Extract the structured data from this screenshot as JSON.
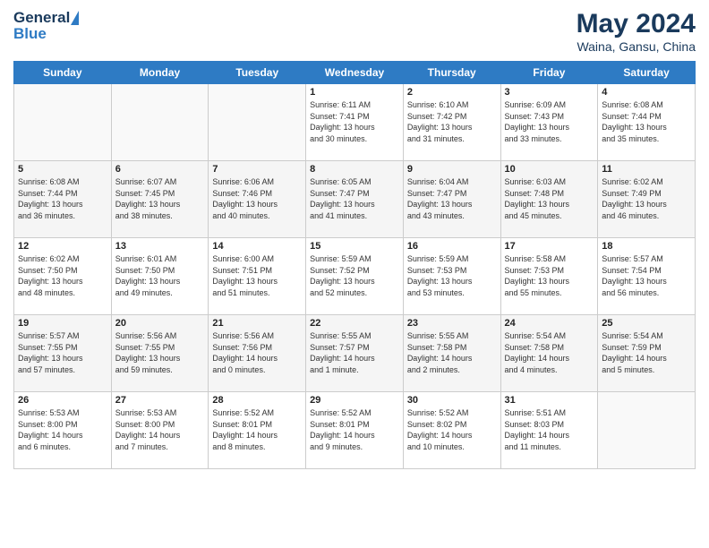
{
  "header": {
    "logo_general": "General",
    "logo_blue": "Blue",
    "title": "May 2024",
    "subtitle": "Waina, Gansu, China"
  },
  "weekdays": [
    "Sunday",
    "Monday",
    "Tuesday",
    "Wednesday",
    "Thursday",
    "Friday",
    "Saturday"
  ],
  "weeks": [
    [
      {
        "day": "",
        "content": ""
      },
      {
        "day": "",
        "content": ""
      },
      {
        "day": "",
        "content": ""
      },
      {
        "day": "1",
        "content": "Sunrise: 6:11 AM\nSunset: 7:41 PM\nDaylight: 13 hours\nand 30 minutes."
      },
      {
        "day": "2",
        "content": "Sunrise: 6:10 AM\nSunset: 7:42 PM\nDaylight: 13 hours\nand 31 minutes."
      },
      {
        "day": "3",
        "content": "Sunrise: 6:09 AM\nSunset: 7:43 PM\nDaylight: 13 hours\nand 33 minutes."
      },
      {
        "day": "4",
        "content": "Sunrise: 6:08 AM\nSunset: 7:44 PM\nDaylight: 13 hours\nand 35 minutes."
      }
    ],
    [
      {
        "day": "5",
        "content": "Sunrise: 6:08 AM\nSunset: 7:44 PM\nDaylight: 13 hours\nand 36 minutes."
      },
      {
        "day": "6",
        "content": "Sunrise: 6:07 AM\nSunset: 7:45 PM\nDaylight: 13 hours\nand 38 minutes."
      },
      {
        "day": "7",
        "content": "Sunrise: 6:06 AM\nSunset: 7:46 PM\nDaylight: 13 hours\nand 40 minutes."
      },
      {
        "day": "8",
        "content": "Sunrise: 6:05 AM\nSunset: 7:47 PM\nDaylight: 13 hours\nand 41 minutes."
      },
      {
        "day": "9",
        "content": "Sunrise: 6:04 AM\nSunset: 7:47 PM\nDaylight: 13 hours\nand 43 minutes."
      },
      {
        "day": "10",
        "content": "Sunrise: 6:03 AM\nSunset: 7:48 PM\nDaylight: 13 hours\nand 45 minutes."
      },
      {
        "day": "11",
        "content": "Sunrise: 6:02 AM\nSunset: 7:49 PM\nDaylight: 13 hours\nand 46 minutes."
      }
    ],
    [
      {
        "day": "12",
        "content": "Sunrise: 6:02 AM\nSunset: 7:50 PM\nDaylight: 13 hours\nand 48 minutes."
      },
      {
        "day": "13",
        "content": "Sunrise: 6:01 AM\nSunset: 7:50 PM\nDaylight: 13 hours\nand 49 minutes."
      },
      {
        "day": "14",
        "content": "Sunrise: 6:00 AM\nSunset: 7:51 PM\nDaylight: 13 hours\nand 51 minutes."
      },
      {
        "day": "15",
        "content": "Sunrise: 5:59 AM\nSunset: 7:52 PM\nDaylight: 13 hours\nand 52 minutes."
      },
      {
        "day": "16",
        "content": "Sunrise: 5:59 AM\nSunset: 7:53 PM\nDaylight: 13 hours\nand 53 minutes."
      },
      {
        "day": "17",
        "content": "Sunrise: 5:58 AM\nSunset: 7:53 PM\nDaylight: 13 hours\nand 55 minutes."
      },
      {
        "day": "18",
        "content": "Sunrise: 5:57 AM\nSunset: 7:54 PM\nDaylight: 13 hours\nand 56 minutes."
      }
    ],
    [
      {
        "day": "19",
        "content": "Sunrise: 5:57 AM\nSunset: 7:55 PM\nDaylight: 13 hours\nand 57 minutes."
      },
      {
        "day": "20",
        "content": "Sunrise: 5:56 AM\nSunset: 7:55 PM\nDaylight: 13 hours\nand 59 minutes."
      },
      {
        "day": "21",
        "content": "Sunrise: 5:56 AM\nSunset: 7:56 PM\nDaylight: 14 hours\nand 0 minutes."
      },
      {
        "day": "22",
        "content": "Sunrise: 5:55 AM\nSunset: 7:57 PM\nDaylight: 14 hours\nand 1 minute."
      },
      {
        "day": "23",
        "content": "Sunrise: 5:55 AM\nSunset: 7:58 PM\nDaylight: 14 hours\nand 2 minutes."
      },
      {
        "day": "24",
        "content": "Sunrise: 5:54 AM\nSunset: 7:58 PM\nDaylight: 14 hours\nand 4 minutes."
      },
      {
        "day": "25",
        "content": "Sunrise: 5:54 AM\nSunset: 7:59 PM\nDaylight: 14 hours\nand 5 minutes."
      }
    ],
    [
      {
        "day": "26",
        "content": "Sunrise: 5:53 AM\nSunset: 8:00 PM\nDaylight: 14 hours\nand 6 minutes."
      },
      {
        "day": "27",
        "content": "Sunrise: 5:53 AM\nSunset: 8:00 PM\nDaylight: 14 hours\nand 7 minutes."
      },
      {
        "day": "28",
        "content": "Sunrise: 5:52 AM\nSunset: 8:01 PM\nDaylight: 14 hours\nand 8 minutes."
      },
      {
        "day": "29",
        "content": "Sunrise: 5:52 AM\nSunset: 8:01 PM\nDaylight: 14 hours\nand 9 minutes."
      },
      {
        "day": "30",
        "content": "Sunrise: 5:52 AM\nSunset: 8:02 PM\nDaylight: 14 hours\nand 10 minutes."
      },
      {
        "day": "31",
        "content": "Sunrise: 5:51 AM\nSunset: 8:03 PM\nDaylight: 14 hours\nand 11 minutes."
      },
      {
        "day": "",
        "content": ""
      }
    ]
  ]
}
